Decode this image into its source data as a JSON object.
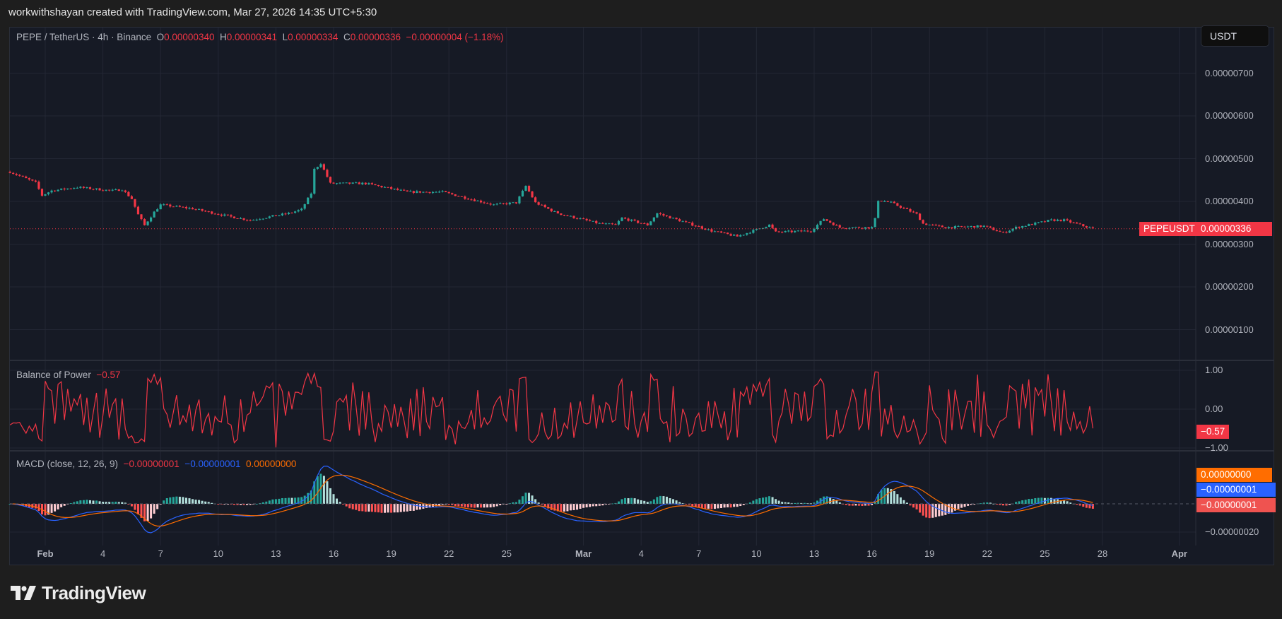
{
  "header": {
    "attribution": "workwithshayan created with TradingView.com, Mar 27, 2026 14:35 UTC+5:30"
  },
  "legend": {
    "symbol": "PEPE / TetherUS · 4h · Binance",
    "o_label": "O",
    "o_value": "0.00000340",
    "h_label": "H",
    "h_value": "0.00000341",
    "l_label": "L",
    "l_value": "0.00000334",
    "c_label": "C",
    "c_value": "0.00000336",
    "change": "−0.00000004 (−1.18%)"
  },
  "currency_button": "USDT",
  "price_tag": {
    "symbol": "PEPEUSDT",
    "value": "0.00000336"
  },
  "bop": {
    "title": "Balance of Power",
    "value": "−0.57",
    "tag": "−0.57",
    "ticks": [
      "1.00",
      "0.00",
      "−1.00"
    ]
  },
  "macd": {
    "title": "MACD (close, 12, 26, 9)",
    "hist_value": "−0.00000001",
    "macd_value": "−0.00000001",
    "signal_value": "0.00000000",
    "tags": {
      "signal": "0.00000000",
      "macd": "−0.00000001",
      "hist": "−0.00000001"
    },
    "ticks": [
      "−0.00000020"
    ]
  },
  "branding": {
    "logo_text": "TradingView"
  },
  "colors": {
    "up": "#26a69a",
    "down": "#f23645",
    "macd": "#2962ff",
    "signal": "#ff6d00",
    "bop": "#f23645",
    "hist_up": "#26a69a",
    "hist_up_weak": "#b2dfdb",
    "hist_down": "#ff5252",
    "hist_down_weak": "#ffcdd2",
    "background": "#161a25"
  },
  "chart_data": {
    "type": "candlestick",
    "interval": "4h",
    "price_axis": {
      "ticks": [
        "0.00000700",
        "0.00000600",
        "0.00000500",
        "0.00000400",
        "0.00000300",
        "0.00000200",
        "0.00000100"
      ],
      "tick_values": [
        7e-06,
        6e-06,
        5e-06,
        4e-06,
        3e-06,
        2e-06,
        1e-06
      ]
    },
    "time_axis": [
      {
        "date": "Feb 1",
        "label": "Feb",
        "month": true
      },
      {
        "date": "Feb 4",
        "label": "4"
      },
      {
        "date": "Feb 7",
        "label": "7"
      },
      {
        "date": "Feb 10",
        "label": "10"
      },
      {
        "date": "Feb 13",
        "label": "13"
      },
      {
        "date": "Feb 16",
        "label": "16"
      },
      {
        "date": "Feb 19",
        "label": "19"
      },
      {
        "date": "Feb 22",
        "label": "22"
      },
      {
        "date": "Feb 25",
        "label": "25"
      },
      {
        "date": "Mar 1",
        "label": "Mar",
        "month": true
      },
      {
        "date": "Mar 4",
        "label": "4"
      },
      {
        "date": "Mar 7",
        "label": "7"
      },
      {
        "date": "Mar 10",
        "label": "10"
      },
      {
        "date": "Mar 13",
        "label": "13"
      },
      {
        "date": "Mar 16",
        "label": "16"
      },
      {
        "date": "Mar 19",
        "label": "19"
      },
      {
        "date": "Mar 22",
        "label": "22"
      },
      {
        "date": "Mar 25",
        "label": "25"
      },
      {
        "date": "Mar 28",
        "label": "28"
      },
      {
        "date": "Apr 1",
        "label": "Apr",
        "month": true
      }
    ],
    "close_path": [
      [
        "Jan 30 04:00",
        4.69e-06
      ],
      [
        "Jan 31 12:00",
        4.44e-06
      ],
      [
        "Jan 31 20:00",
        4.14e-06
      ],
      [
        "Feb 1 08:00",
        4.25e-06
      ],
      [
        "Feb 2 16:00",
        4.33e-06
      ],
      [
        "Feb 4 12:00",
        4.25e-06
      ],
      [
        "Feb 5 00:00",
        4.28e-06
      ],
      [
        "Feb 5 12:00",
        4.06e-06
      ],
      [
        "Feb 5 20:00",
        3.69e-06
      ],
      [
        "Feb 6 04:00",
        3.44e-06
      ],
      [
        "Feb 6 16:00",
        3.75e-06
      ],
      [
        "Feb 7 00:00",
        3.92e-06
      ],
      [
        "Feb 8 16:00",
        3.83e-06
      ],
      [
        "Feb 10 16:00",
        3.64e-06
      ],
      [
        "Feb 11 16:00",
        3.56e-06
      ],
      [
        "Feb 13 16:00",
        3.72e-06
      ],
      [
        "Feb 14 08:00",
        3.81e-06
      ],
      [
        "Feb 14 20:00",
        4.19e-06
      ],
      [
        "Feb 15 00:00",
        4.75e-06
      ],
      [
        "Feb 15 08:00",
        4.89e-06
      ],
      [
        "Feb 15 20:00",
        4.42e-06
      ],
      [
        "Feb 17 16:00",
        4.42e-06
      ],
      [
        "Feb 19 20:00",
        4.22e-06
      ],
      [
        "Feb 21 16:00",
        4.22e-06
      ],
      [
        "Feb 23 08:00",
        4.03e-06
      ],
      [
        "Feb 24 08:00",
        3.92e-06
      ],
      [
        "Feb 25 12:00",
        3.97e-06
      ],
      [
        "Feb 26 00:00",
        4.36e-06
      ],
      [
        "Feb 26 12:00",
        3.97e-06
      ],
      [
        "Feb 27 12:00",
        3.75e-06
      ],
      [
        "Feb 28 00:00",
        3.68e-06
      ],
      [
        "Mar 1 20:00",
        3.48e-06
      ],
      [
        "Mar 2 16:00",
        3.45e-06
      ],
      [
        "Mar 3 00:00",
        3.61e-06
      ],
      [
        "Mar 4 08:00",
        3.45e-06
      ],
      [
        "Mar 4 20:00",
        3.72e-06
      ],
      [
        "Mar 6 12:00",
        3.48e-06
      ],
      [
        "Mar 7 16:00",
        3.31e-06
      ],
      [
        "Mar 9 00:00",
        3.18e-06
      ],
      [
        "Mar 10 16:00",
        3.45e-06
      ],
      [
        "Mar 11 00:00",
        3.28e-06
      ],
      [
        "Mar 12 20:00",
        3.31e-06
      ],
      [
        "Mar 13 12:00",
        3.59e-06
      ],
      [
        "Mar 14 08:00",
        3.39e-06
      ],
      [
        "Mar 16 00:00",
        3.39e-06
      ],
      [
        "Mar 16 04:00",
        3.59e-06
      ],
      [
        "Mar 16 08:00",
        4.03e-06
      ],
      [
        "Mar 17 00:00",
        3.97e-06
      ],
      [
        "Mar 18 08:00",
        3.7e-06
      ],
      [
        "Mar 18 16:00",
        3.48e-06
      ],
      [
        "Mar 19 20:00",
        3.39e-06
      ],
      [
        "Mar 21 20:00",
        3.42e-06
      ],
      [
        "Mar 22 20:00",
        3.26e-06
      ],
      [
        "Mar 23 12:00",
        3.39e-06
      ],
      [
        "Mar 25 08:00",
        3.56e-06
      ],
      [
        "Mar 26 00:00",
        3.56e-06
      ],
      [
        "Mar 27 12:00",
        3.36e-06
      ]
    ],
    "last": {
      "open": 3.4e-06,
      "high": 3.41e-06,
      "low": 3.34e-06,
      "close": 3.36e-06
    }
  }
}
